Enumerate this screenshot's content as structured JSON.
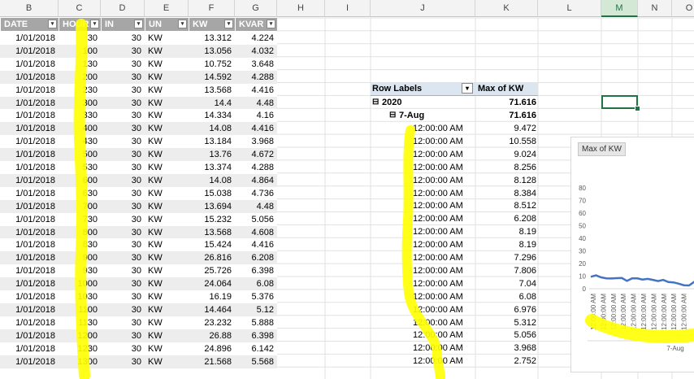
{
  "columns": [
    "B",
    "C",
    "D",
    "E",
    "F",
    "G",
    "H",
    "I",
    "J",
    "K",
    "L",
    "M",
    "N",
    "O"
  ],
  "selected_column": "M",
  "table": {
    "headers": [
      "DATE",
      "HOUR",
      "IN",
      "UN",
      "KW",
      "KVAR"
    ],
    "rows": [
      [
        "1/01/2018",
        "30",
        "30",
        "KW",
        "13.312",
        "4.224"
      ],
      [
        "1/01/2018",
        "100",
        "30",
        "KW",
        "13.056",
        "4.032"
      ],
      [
        "1/01/2018",
        "130",
        "30",
        "KW",
        "10.752",
        "3.648"
      ],
      [
        "1/01/2018",
        "200",
        "30",
        "KW",
        "14.592",
        "4.288"
      ],
      [
        "1/01/2018",
        "230",
        "30",
        "KW",
        "13.568",
        "4.416"
      ],
      [
        "1/01/2018",
        "300",
        "30",
        "KW",
        "14.4",
        "4.48"
      ],
      [
        "1/01/2018",
        "330",
        "30",
        "KW",
        "14.334",
        "4.16"
      ],
      [
        "1/01/2018",
        "400",
        "30",
        "KW",
        "14.08",
        "4.416"
      ],
      [
        "1/01/2018",
        "430",
        "30",
        "KW",
        "13.184",
        "3.968"
      ],
      [
        "1/01/2018",
        "500",
        "30",
        "KW",
        "13.76",
        "4.672"
      ],
      [
        "1/01/2018",
        "530",
        "30",
        "KW",
        "13.374",
        "4.288"
      ],
      [
        "1/01/2018",
        "600",
        "30",
        "KW",
        "14.08",
        "4.864"
      ],
      [
        "1/01/2018",
        "630",
        "30",
        "KW",
        "15.038",
        "4.736"
      ],
      [
        "1/01/2018",
        "700",
        "30",
        "KW",
        "13.694",
        "4.48"
      ],
      [
        "1/01/2018",
        "730",
        "30",
        "KW",
        "15.232",
        "5.056"
      ],
      [
        "1/01/2018",
        "800",
        "30",
        "KW",
        "13.568",
        "4.608"
      ],
      [
        "1/01/2018",
        "830",
        "30",
        "KW",
        "15.424",
        "4.416"
      ],
      [
        "1/01/2018",
        "900",
        "30",
        "KW",
        "26.816",
        "6.208"
      ],
      [
        "1/01/2018",
        "930",
        "30",
        "KW",
        "25.726",
        "6.398"
      ],
      [
        "1/01/2018",
        "1000",
        "30",
        "KW",
        "24.064",
        "6.08"
      ],
      [
        "1/01/2018",
        "1030",
        "30",
        "KW",
        "16.19",
        "5.376"
      ],
      [
        "1/01/2018",
        "1100",
        "30",
        "KW",
        "14.464",
        "5.12"
      ],
      [
        "1/01/2018",
        "1130",
        "30",
        "KW",
        "23.232",
        "5.888"
      ],
      [
        "1/01/2018",
        "1200",
        "30",
        "KW",
        "26.88",
        "6.398"
      ],
      [
        "1/01/2018",
        "1230",
        "30",
        "KW",
        "24.896",
        "6.142"
      ],
      [
        "1/01/2018",
        "1300",
        "30",
        "KW",
        "21.568",
        "5.568"
      ]
    ]
  },
  "pivot": {
    "header_labels": "Row Labels",
    "header_value": "Max of  KW",
    "year_label": "2020",
    "year_value": "71.616",
    "month_label": "7-Aug",
    "month_value": "71.616",
    "expand_glyph": "⊟",
    "rows": [
      [
        "12:00:00 AM",
        "9.472"
      ],
      [
        "12:00:00 AM",
        "10.558"
      ],
      [
        "12:00:00 AM",
        "9.024"
      ],
      [
        "12:00:00 AM",
        "8.256"
      ],
      [
        "12:00:00 AM",
        "8.128"
      ],
      [
        "12:00:00 AM",
        "8.384"
      ],
      [
        "12:00:00 AM",
        "8.512"
      ],
      [
        "12:00:00 AM",
        "6.208"
      ],
      [
        "12:00:00 AM",
        "8.19"
      ],
      [
        "12:00:00 AM",
        "8.19"
      ],
      [
        "12:00:00 AM",
        "7.296"
      ],
      [
        "12:00:00 AM",
        "7.806"
      ],
      [
        "12:00:00 AM",
        "7.04"
      ],
      [
        "12:00:00 AM",
        "6.08"
      ],
      [
        "12:00:00 AM",
        "6.976"
      ],
      [
        "12:00:00 AM",
        "5.312"
      ],
      [
        "12:00:00 AM",
        "5.056"
      ],
      [
        "12:00:00 AM",
        "3.968"
      ],
      [
        "12:00:00 AM",
        "2.752"
      ]
    ]
  },
  "chart_data": {
    "type": "line",
    "legend_button": "Max of  KW",
    "y_ticks": [
      "80",
      "70",
      "60",
      "50",
      "40",
      "30",
      "20",
      "10",
      "0"
    ],
    "ylim": [
      0,
      80
    ],
    "values": [
      9.472,
      10.558,
      9.024,
      8.256,
      8.128,
      8.384,
      8.512,
      6.208,
      8.19,
      8.19,
      7.296,
      7.806,
      7.04,
      6.08,
      6.976,
      5.312,
      5.056,
      3.968,
      2.752,
      2.6,
      5.5,
      7.2,
      6.8
    ],
    "x_tick_label": "12:00:00 AM",
    "x_tick_count": 10,
    "x_group_label": "7-Aug",
    "line_color": "#4472c4"
  }
}
